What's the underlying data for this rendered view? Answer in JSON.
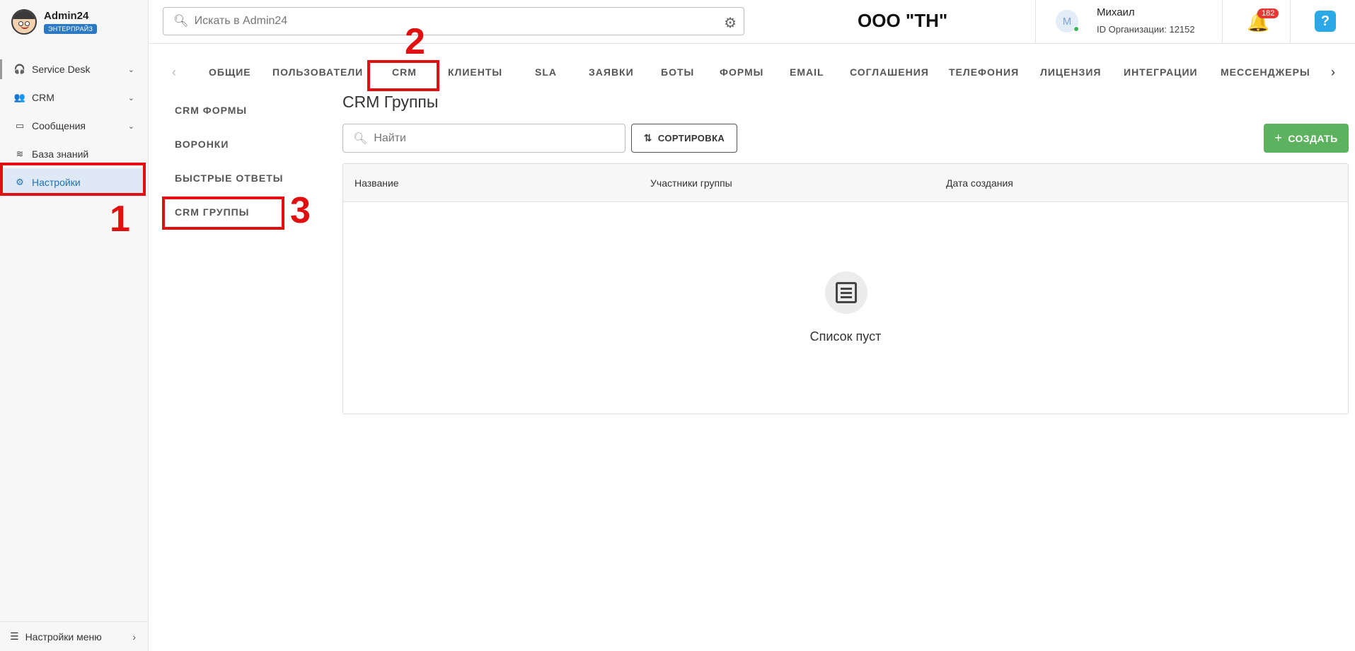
{
  "brand": {
    "name": "Admin24",
    "badge": "ЭНТЕРПРАЙЗ"
  },
  "sidebar": {
    "items": [
      {
        "label": "Service Desk",
        "icon": "headset-icon",
        "has_chevron": true
      },
      {
        "label": "CRM",
        "icon": "users-icon",
        "has_chevron": true
      },
      {
        "label": "Сообщения",
        "icon": "chat-icon",
        "has_chevron": true
      },
      {
        "label": "База знаний",
        "icon": "database-icon",
        "has_chevron": false
      },
      {
        "label": "Настройки",
        "icon": "gear-icon",
        "has_chevron": false,
        "active": true
      }
    ],
    "bottom_label": "Настройки меню"
  },
  "header": {
    "search_placeholder": "Искать в Admin24",
    "org_title": "ООО \"ТН\"",
    "user_initial": "М",
    "user_name": "Михаил",
    "org_id": "ID Организации: 12152",
    "notifications_count": "182",
    "help_label": "?"
  },
  "tabs": [
    "ОБЩИЕ",
    "ПОЛЬЗОВАТЕЛИ",
    "CRM",
    "КЛИЕНТЫ",
    "SLA",
    "ЗАЯВКИ",
    "БОТЫ",
    "ФОРМЫ",
    "EMAIL",
    "СОГЛАШЕНИЯ",
    "ТЕЛЕФОНИЯ",
    "ЛИЦЕНЗИЯ",
    "ИНТЕГРАЦИИ",
    "МЕССЕНДЖЕРЫ"
  ],
  "submenu": [
    "CRM ФОРМЫ",
    "ВОРОНКИ",
    "БЫСТРЫЕ ОТВЕТЫ",
    "CRM ГРУППЫ"
  ],
  "main": {
    "title": "CRM Группы",
    "find_placeholder": "Найти",
    "sort_label": "СОРТИРОВКА",
    "create_label": "СОЗДАТЬ",
    "columns": [
      "Название",
      "Участники группы",
      "Дата создания"
    ],
    "empty_text": "Список пуст"
  },
  "annotations": [
    "1",
    "2",
    "3"
  ],
  "colors": {
    "accent": "#1f6fb8",
    "create": "#5cb25f",
    "annotation": "#e01010",
    "badge": "#e53935"
  }
}
